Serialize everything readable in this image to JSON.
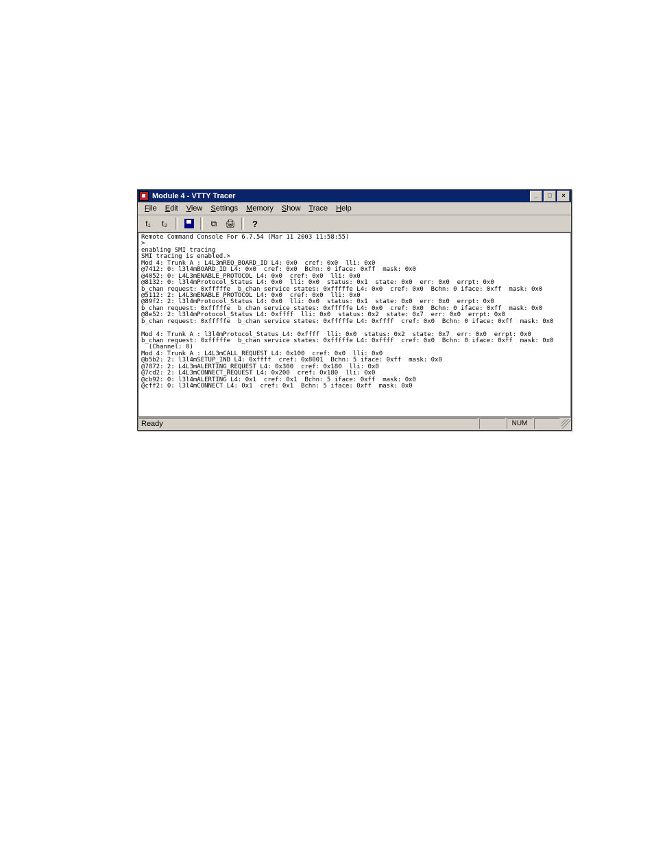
{
  "window": {
    "title": "Module 4 - VTTY Tracer",
    "menus": [
      "File",
      "Edit",
      "View",
      "Settings",
      "Memory",
      "Show",
      "Trace",
      "Help"
    ],
    "win_btn_min": "_",
    "win_btn_max": "□",
    "win_btn_close": "×"
  },
  "toolbar": {
    "t1": "t₁",
    "t2": "t₂",
    "save_name": "save-icon",
    "copy_name": "copy-icon",
    "print_name": "print-icon",
    "help_label": "?"
  },
  "console_lines": [
    "Remote Command Console For 6.7.54 (Mar 11 2003 11:58:55)",
    ">",
    "enabling SMI tracing",
    "SMI tracing is enabled.>",
    "Mod 4: Trunk A : L4L3mREQ_BOARD_ID L4: 0x0  cref: 0x0  lli: 0x0",
    "@7412: 0: l3l4mBOARD_ID L4: 0x0  cref: 0x0  Bchn: 0 iface: 0xff  mask: 0x0",
    "@4052: 0: L4L3mENABLE_PROTOCOL L4: 0x0  cref: 0x0  lli: 0x0",
    "@8132: 0: l3l4mProtocol_Status L4: 0x0  lli: 0x0  status: 0x1  state: 0x0  err: 0x0  errpt: 0x0",
    "b_chan request: 0xfffffe  b_chan service states: 0xfffffe L4: 0x0  cref: 0x0  Bchn: 0 iface: 0xff  mask: 0x0",
    "@5112: 2: L4L3mENABLE_PROTOCOL L4: 0x0  cref: 0x0  lli: 0x0",
    "@89f2: 2: l3l4mProtocol_Status L4: 0x0  lli: 0x0  status: 0x1  state: 0x0  err: 0x0  errpt: 0x0",
    "b_chan request: 0xfffffe  b_chan service states: 0xfffffe L4: 0x0  cref: 0x0  Bchn: 0 iface: 0xff  mask: 0x0",
    "@8e52: 2: l3l4mProtocol_Status L4: 0xffff  lli: 0x0  status: 0x2  state: 0x7  err: 0x0  errpt: 0x0",
    "b_chan request: 0xfffffe  b_chan service states: 0xfffffe L4: 0xffff  cref: 0x0  Bchn: 0 iface: 0xff  mask: 0x0",
    "",
    "Mod 4: Trunk A : l3l4mProtocol_Status L4: 0xffff  lli: 0x0  status: 0x2  state: 0x7  err: 0x0  errpt: 0x0",
    "b_chan request: 0xfffffe  b_chan service states: 0xfffffe L4: 0xffff  cref: 0x0  Bchn: 0 iface: 0xff  mask: 0x0",
    "  (Channel: 0)",
    "Mod 4: Trunk A : L4L3mCALL_REQUEST L4: 0x100  cref: 0x0  lli: 0x0",
    "@b5b2: 2: l3l4mSETUP_IND L4: 0xffff  cref: 0x8001  Bchn: 5 iface: 0xff  mask: 0x0",
    "@7872: 2: L4L3mALERTING_REQUEST L4: 0x300  cref: 0x180  lli: 0x0",
    "@7cd2: 2: L4L3mCONNECT_REQUEST L4: 0x200  cref: 0x180  lli: 0x0",
    "@cb92: 0: l3l4mALERTING L4: 0x1  cref: 0x1  Bchn: 5 iface: 0xff  mask: 0x0",
    "@cff2: 0: l3l4mCONNECT L4: 0x1  cref: 0x1  Bchn: 5 iface: 0xff  mask: 0x0"
  ],
  "statusbar": {
    "ready": "Ready",
    "num": "NUM"
  },
  "chart_data": null
}
